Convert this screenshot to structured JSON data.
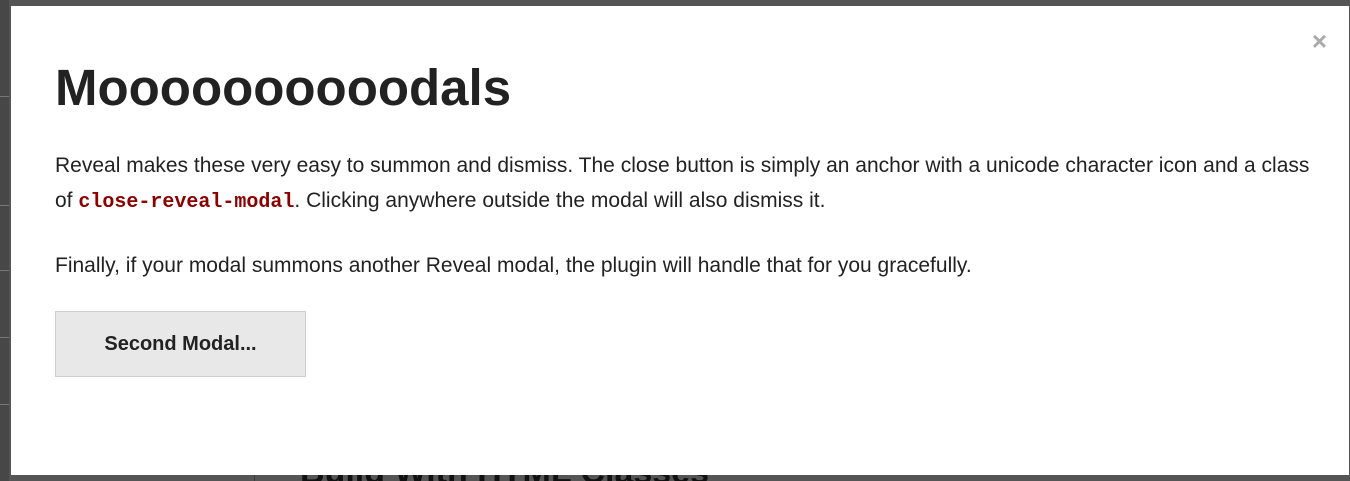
{
  "backdrop": {
    "heading": "Build With HTML Classes"
  },
  "modal": {
    "close_glyph": "×",
    "title": "Moooooooooodals",
    "paragraph1": {
      "before_code": "Reveal makes these very easy to summon and dismiss. The close button is simply an anchor with a unicode character icon and a class of ",
      "code": "close-reveal-modal",
      "after_code": ". Clicking anywhere outside the modal will also dismiss it."
    },
    "paragraph2": "Finally, if your modal summons another Reveal modal, the plugin will handle that for you gracefully.",
    "second_button_label": "Second Modal..."
  },
  "colors": {
    "overlay": "#000000",
    "modal_background": "#ffffff",
    "text": "#222222",
    "code": "#8b0000",
    "button_background": "#e8e8e8",
    "close_icon": "#aaaaaa"
  },
  "icons": {
    "close": "close-icon"
  }
}
